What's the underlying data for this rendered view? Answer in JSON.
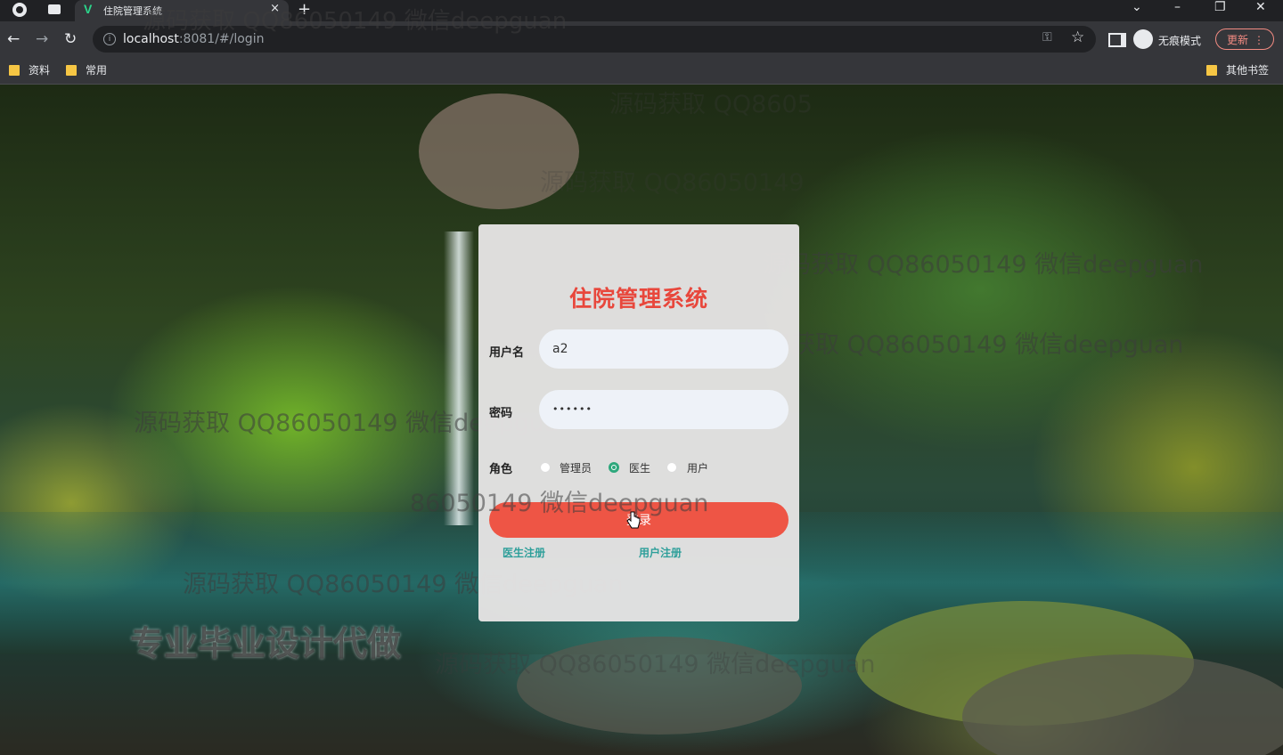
{
  "browser": {
    "tab_title": "住院管理系统",
    "tab_icon": "V",
    "tab_close": "×",
    "new_tab": "+",
    "window_min": "–",
    "window_restore": "❐",
    "window_close": "✕",
    "url_host": "localhost",
    "url_rest": ":8081/#/login",
    "incognito_label": "无痕模式",
    "update_label": "更新",
    "bookmarks": [
      "资料",
      "常用"
    ],
    "other_bookmarks": "其他书签"
  },
  "login": {
    "title": "住院管理系统",
    "username_label": "用户名",
    "username_value": "a2",
    "password_label": "密码",
    "password_value": "••••••",
    "role_label": "角色",
    "roles": [
      "管理员",
      "医生",
      "用户"
    ],
    "selected_role": "医生",
    "login_button": "登录",
    "doctor_register": "医生注册",
    "user_register": "用户注册"
  },
  "watermarks": {
    "tab_text": "源码获取 QQ86050149 微信deepguan",
    "text": "源码获取 QQ86050149 微信deepguan",
    "partial_1": "源码获取 QQ8605",
    "partial_2": "源码获取 QQ86050149",
    "partial_3": "源码获取 QQ86050149 微信deepguan",
    "partial_4": "源码获取 QQ86050149 微信deepguan",
    "partial_5": "源码获取 QQ86050149 微信deepguan",
    "partial_6": "86050149 微信deepguan",
    "slogan": "专业毕业设计代做"
  },
  "colors": {
    "title_red": "#e8473c",
    "button_red": "#ee5545",
    "link_teal": "#2e9f9a",
    "radio_green": "#2ea87c"
  }
}
